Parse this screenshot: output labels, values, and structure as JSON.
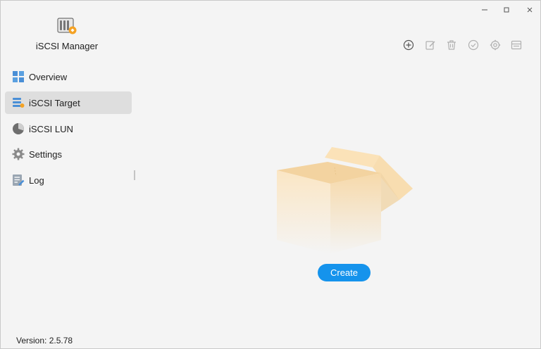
{
  "app": {
    "title": "iSCSI Manager",
    "version_text": "Version: 2.5.78"
  },
  "window_controls": [
    {
      "name": "minimize",
      "icon": "minimize-icon"
    },
    {
      "name": "maximize",
      "icon": "maximize-icon"
    },
    {
      "name": "close",
      "icon": "close-icon"
    }
  ],
  "sidebar": {
    "items": [
      {
        "label": "Overview",
        "icon": "overview-grid-icon",
        "active": false
      },
      {
        "label": "iSCSI Target",
        "icon": "iscsi-target-icon",
        "active": true
      },
      {
        "label": "iSCSI LUN",
        "icon": "lun-disk-icon",
        "active": false
      },
      {
        "label": "Settings",
        "icon": "gear-icon",
        "active": false
      },
      {
        "label": "Log",
        "icon": "log-icon",
        "active": false
      }
    ]
  },
  "toolbar": {
    "buttons": [
      {
        "name": "add",
        "icon": "plus-circle-icon",
        "enabled": true
      },
      {
        "name": "edit",
        "icon": "edit-icon",
        "enabled": false
      },
      {
        "name": "delete",
        "icon": "trash-icon",
        "enabled": false
      },
      {
        "name": "enable",
        "icon": "check-circle-icon",
        "enabled": false
      },
      {
        "name": "settings",
        "icon": "gear-icon",
        "enabled": false
      },
      {
        "name": "info",
        "icon": "info-panel-icon",
        "enabled": false
      }
    ]
  },
  "main": {
    "empty_state_icon": "empty-box-icon",
    "create_label": "Create"
  },
  "colors": {
    "accent": "#1593ec",
    "active_nav_bg": "#dedede",
    "background": "#f4f4f4",
    "box_fill": "#fbe6c4"
  }
}
